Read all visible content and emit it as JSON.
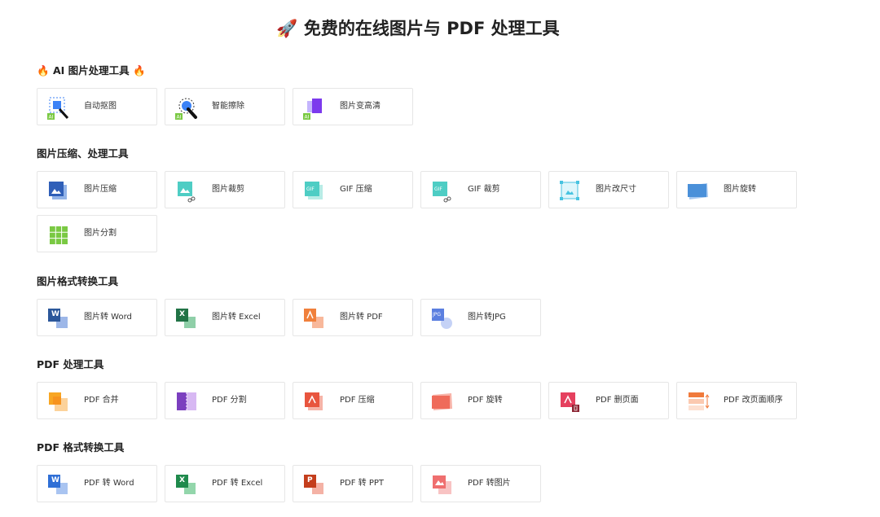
{
  "page": {
    "title_emoji": "🚀",
    "title": "免费的在线图片与 PDF 处理工具"
  },
  "sections": {
    "ai": {
      "prefix": "🔥",
      "label": "AI 图片处理工具",
      "suffix": "🔥",
      "items": [
        {
          "label": "自动抠图",
          "icon": "auto-cutout-icon"
        },
        {
          "label": "智能擦除",
          "icon": "smart-erase-icon"
        },
        {
          "label": "图片变高清",
          "icon": "image-enhance-icon"
        }
      ]
    },
    "compress": {
      "label": "图片压缩、处理工具",
      "items": [
        {
          "label": "图片压缩",
          "icon": "image-compress-icon"
        },
        {
          "label": "图片裁剪",
          "icon": "image-crop-icon"
        },
        {
          "label": "GIF 压缩",
          "icon": "gif-compress-icon",
          "badge": "GIF"
        },
        {
          "label": "GIF 裁剪",
          "icon": "gif-crop-icon",
          "badge": "GIF"
        },
        {
          "label": "图片改尺寸",
          "icon": "image-resize-icon"
        },
        {
          "label": "图片旋转",
          "icon": "image-rotate-icon"
        },
        {
          "label": "图片分割",
          "icon": "image-split-icon"
        }
      ]
    },
    "format": {
      "label": "图片格式转换工具",
      "items": [
        {
          "label": "图片转 Word",
          "icon": "word-icon",
          "badge": "W"
        },
        {
          "label": "图片转 Excel",
          "icon": "excel-icon",
          "badge": "X"
        },
        {
          "label": "图片转 PDF",
          "icon": "pdf-icon"
        },
        {
          "label": "图片转JPG",
          "icon": "jpg-icon",
          "badge": "JPG"
        }
      ]
    },
    "pdf": {
      "label": "PDF 处理工具",
      "items": [
        {
          "label": "PDF 合并",
          "icon": "pdf-merge-icon"
        },
        {
          "label": "PDF 分割",
          "icon": "pdf-split-icon"
        },
        {
          "label": "PDF 压缩",
          "icon": "pdf-compress-icon"
        },
        {
          "label": "PDF 旋转",
          "icon": "pdf-rotate-icon"
        },
        {
          "label": "PDF 删页面",
          "icon": "pdf-delete-page-icon"
        },
        {
          "label": "PDF 改页面顺序",
          "icon": "pdf-reorder-icon"
        }
      ]
    },
    "pdfconv": {
      "label": "PDF 格式转换工具",
      "items": [
        {
          "label": "PDF 转 Word",
          "icon": "pdf-to-word-icon",
          "badge": "W"
        },
        {
          "label": "PDF 转 Excel",
          "icon": "pdf-to-excel-icon",
          "badge": "X"
        },
        {
          "label": "PDF 转 PPT",
          "icon": "pdf-to-ppt-icon",
          "badge": "P"
        },
        {
          "label": "PDF 转图片",
          "icon": "pdf-to-image-icon"
        }
      ]
    }
  },
  "colors": {
    "word": "#2b579a",
    "excel": "#217346",
    "pdf": "#e8553e",
    "ppt": "#c43e1c",
    "ai_badge": "#7ac943",
    "blue": "#3b82f6",
    "teal": "#4ecdc4",
    "purple": "#7c3aed"
  }
}
